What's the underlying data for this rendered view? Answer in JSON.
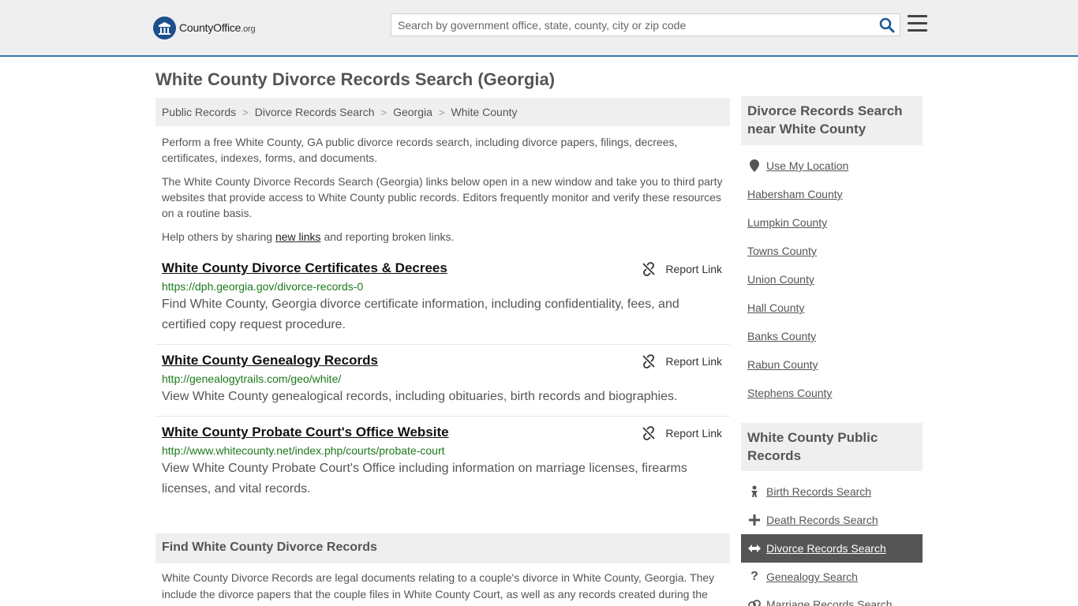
{
  "header": {
    "logo_text": "CountyOffice",
    "logo_tld": ".org",
    "search_placeholder": "Search by government office, state, county, city or zip code"
  },
  "page": {
    "title": "White County Divorce Records Search (Georgia)",
    "breadcrumb": [
      "Public Records",
      "Divorce Records Search",
      "Georgia",
      "White County"
    ],
    "intro_1": "Perform a free White County, GA public divorce records search, including divorce papers, filings, decrees, certificates, indexes, forms, and documents.",
    "intro_2": "The White County Divorce Records Search (Georgia) links below open in a new window and take you to third party websites that provide access to White County public records. Editors frequently monitor and verify these resources on a routine basis.",
    "intro_3_pre": "Help others by sharing ",
    "intro_3_link": "new links",
    "intro_3_post": " and reporting broken links."
  },
  "results": [
    {
      "title": "White County Divorce Certificates & Decrees",
      "url": "https://dph.georgia.gov/divorce-records-0",
      "desc": "Find White County, Georgia divorce certificate information, including confidentiality, fees, and certified copy request procedure.",
      "report": "Report Link"
    },
    {
      "title": "White County Genealogy Records",
      "url": "http://genealogytrails.com/geo/white/",
      "desc": "View White County genealogical records, including obituaries, birth records and biographies.",
      "report": "Report Link"
    },
    {
      "title": "White County Probate Court's Office Website",
      "url": "http://www.whitecounty.net/index.php/courts/probate-court",
      "desc": "View White County Probate Court's Office including information on marriage licenses, firearms licenses, and vital records.",
      "report": "Report Link"
    }
  ],
  "find_section": {
    "heading": "Find White County Divorce Records",
    "text": "White County Divorce Records are legal documents relating to a couple's divorce in White County, Georgia. They include the divorce papers that the couple files in White County Court, as well as any records created during the"
  },
  "sidebar": {
    "nearby_heading": "Divorce Records Search near White County",
    "use_location": "Use My Location",
    "nearby": [
      "Habersham County",
      "Lumpkin County",
      "Towns County",
      "Union County",
      "Hall County",
      "Banks County",
      "Rabun County",
      "Stephens County"
    ],
    "public_heading": "White County Public Records",
    "public_links": [
      {
        "label": "Birth Records Search",
        "icon": "baby-icon"
      },
      {
        "label": "Death Records Search",
        "icon": "cross-icon"
      },
      {
        "label": "Divorce Records Search",
        "icon": "arrows-icon"
      },
      {
        "label": "Genealogy Search",
        "icon": "question-icon"
      },
      {
        "label": "Marriage Records Search",
        "icon": "rings-icon"
      }
    ]
  }
}
